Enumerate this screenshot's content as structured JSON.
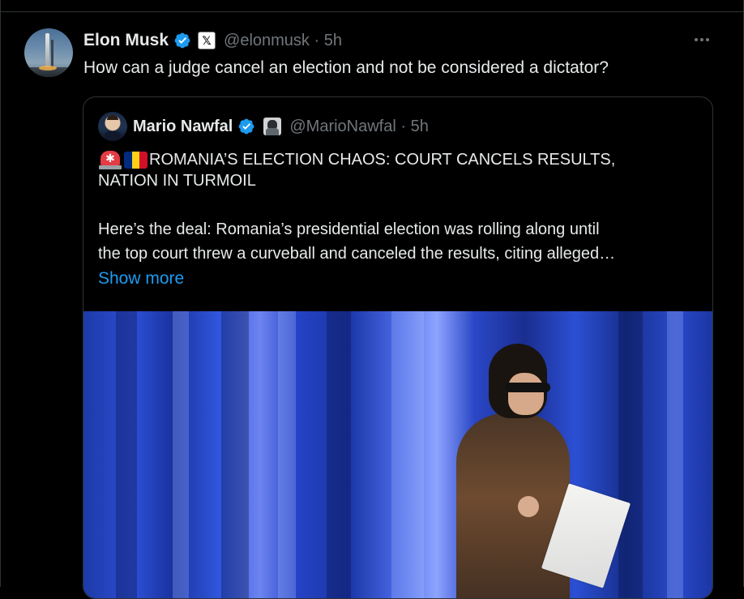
{
  "tweet": {
    "author_name": "Elon Musk",
    "affiliation_badge": "𝕏",
    "handle": "@elonmusk",
    "time": "5h",
    "text": "How can a judge cancel an election and not be considered a dictator?",
    "icons": [
      "verified-badge-icon",
      "x-affiliate-icon",
      "more-icon"
    ],
    "colors": {
      "verified": "#1d9bf0",
      "muted": "#71767b",
      "text": "#e7e9ea",
      "background": "#000000"
    }
  },
  "quote": {
    "author_name": "Mario Nawfal",
    "handle": "@MarioNawfal",
    "time": "5h",
    "emoji_siren": "🚨",
    "emoji_flag": "🇷🇴",
    "headline_line1": "ROMANIA’S ELECTION CHAOS: COURT CANCELS RESULTS,",
    "headline_line2": "NATION IN TURMOIL",
    "body_line1": "Here’s the deal: Romania’s presidential election was rolling along until",
    "body_line2": "the top court threw a curveball and canceled the results, citing alleged…",
    "show_more": "Show more",
    "link_color": "#1d9bf0",
    "flag_colors": [
      "#002b7f",
      "#fcd116",
      "#ce1126"
    ]
  }
}
